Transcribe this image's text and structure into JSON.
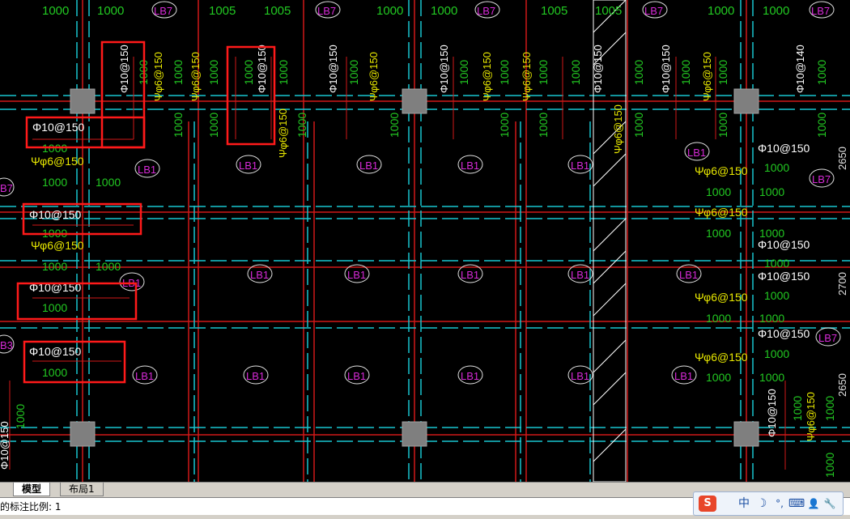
{
  "drawing": {
    "dim_texts": [
      "1000",
      "1005",
      "2650",
      "2700",
      "2650"
    ],
    "rebar_10_150": "Φ10@150",
    "rebar_10_140": "Φ10@140",
    "rebar_6_150": "Φ6@150",
    "rebar_6_150_yellow": "Ψφ6@150",
    "slab_lb1": "LB1",
    "slab_lb7": "LB7",
    "slab_lb3": "B7",
    "slab_b3": "B3",
    "len_1000": "1000",
    "len_1005": "1005",
    "right_dims": [
      "2650",
      "2700",
      "2650"
    ]
  },
  "tabs": {
    "model": "模型",
    "layout1": "布局1"
  },
  "command_line": {
    "text": "的标注比例: 1"
  },
  "ime": {
    "logo": "S",
    "items": [
      "中",
      "☽",
      "°,",
      "⌨",
      "👤",
      "🔧"
    ]
  }
}
